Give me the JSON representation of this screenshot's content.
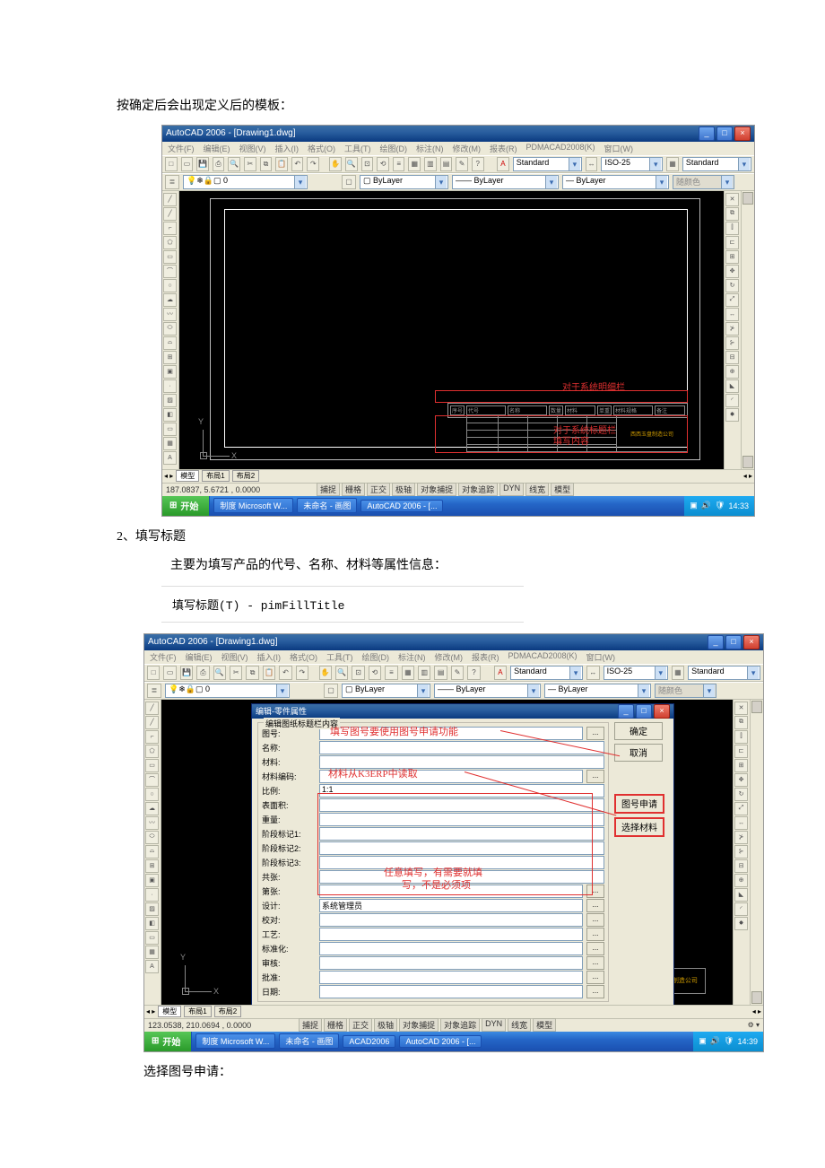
{
  "texts": {
    "p1": "按确定后会出现定义后的模板：",
    "p2_num": "2、填写标题",
    "p2_desc": "主要为填写产品的代号、名称、材料等属性信息：",
    "menu_item": "填写标题(T) - pimFillTitle",
    "p3": "选择图号申请："
  },
  "autocad": {
    "title": "AutoCAD 2006 - [Drawing1.dwg]",
    "menus": [
      "文件(F)",
      "编辑(E)",
      "视图(V)",
      "插入(I)",
      "格式(O)",
      "工具(T)",
      "绘图(D)",
      "标注(N)",
      "修改(M)",
      "报表(R)",
      "PDMACAD2008(K)",
      "窗口(W)"
    ],
    "combo_layer": "0",
    "combo_bylayer": "ByLayer",
    "combo_bylayer2": "ByLayer",
    "combo_bylayer3": "ByLayer",
    "combo_style": "Standard",
    "combo_dim": "ISO-25",
    "combo_tblstyle": "Standard",
    "combo_color": "随颜色",
    "tab_model": "模型",
    "tab_layout1": "布局1",
    "tab_layout2": "布局2",
    "coords1": "187.0837, 5.6721 , 0.0000",
    "coords2": "123.0538, 210.0694 , 0.0000",
    "toggles": [
      "捕捉",
      "栅格",
      "正交",
      "极轴",
      "对象捕捉",
      "对象追踪",
      "DYN",
      "线宽",
      "模型"
    ],
    "anno_top": "对于系统明细栏",
    "anno_top2": "填写内容",
    "anno_bottom": "对于系统标题栏",
    "anno_bottom2": "填写内容",
    "tb_headers": [
      "序号",
      "代号",
      "名称",
      "数量",
      "材料",
      "单重",
      "材料规格",
      "备注"
    ],
    "company": "西西玉盘制造公司"
  },
  "taskbar": {
    "start": "开始",
    "tasks1": [
      "制度 Microsoft W...",
      "未命名 - 画图",
      "AutoCAD 2006 - [..."
    ],
    "tasks2": [
      "制度 Microsoft W...",
      "未命名 - 画图",
      "ACAD2006",
      "AutoCAD 2006 - [..."
    ],
    "time1": "14:33",
    "time2": "14:39"
  },
  "dialog": {
    "title": "编辑-零件属性",
    "groupbox": "编辑图纸标题栏内容",
    "fields": [
      {
        "label": "图号:",
        "value": ""
      },
      {
        "label": "名称:",
        "value": ""
      },
      {
        "label": "材料:",
        "value": ""
      },
      {
        "label": "材料编码:",
        "value": ""
      },
      {
        "label": "比例:",
        "value": "1:1"
      },
      {
        "label": "表面积:",
        "value": ""
      },
      {
        "label": "重量:",
        "value": ""
      },
      {
        "label": "阶段标记1:",
        "value": ""
      },
      {
        "label": "阶段标记2:",
        "value": ""
      },
      {
        "label": "阶段标记3:",
        "value": ""
      },
      {
        "label": "共张:",
        "value": ""
      },
      {
        "label": "第张:",
        "value": ""
      },
      {
        "label": "设计:",
        "value": "系统管理员"
      },
      {
        "label": "校对:",
        "value": ""
      },
      {
        "label": "工艺:",
        "value": ""
      },
      {
        "label": "标准化:",
        "value": ""
      },
      {
        "label": "审核:",
        "value": ""
      },
      {
        "label": "批准:",
        "value": ""
      },
      {
        "label": "日期:",
        "value": ""
      }
    ],
    "btn_ok": "确定",
    "btn_cancel": "取消",
    "btn_apply_num": "图号申请",
    "btn_material": "选择材料",
    "anno1": "填写图号要使用图号申请功能",
    "anno2": "材料从K3ERP中读取",
    "anno3a": "任意填写，有需要就填",
    "anno3b": "写，不是必须项"
  }
}
